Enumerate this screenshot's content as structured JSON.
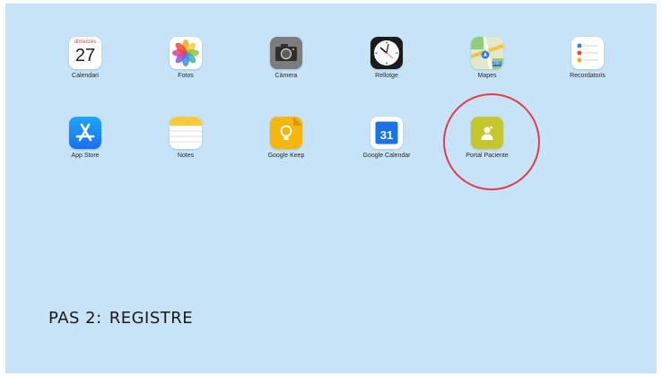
{
  "apps": [
    {
      "id": "calendari",
      "label": "Calendari",
      "weekday": "dimecres",
      "day": "27"
    },
    {
      "id": "fotos",
      "label": "Fotos"
    },
    {
      "id": "camera",
      "label": "Càmera"
    },
    {
      "id": "rellotge",
      "label": "Rellotge"
    },
    {
      "id": "mapes",
      "label": "Mapes",
      "badge": "280"
    },
    {
      "id": "recordatoris",
      "label": "Recordatoris"
    },
    {
      "id": "appstore",
      "label": "App Store"
    },
    {
      "id": "notes",
      "label": "Notes"
    },
    {
      "id": "keep",
      "label": "Google Keep"
    },
    {
      "id": "gcal",
      "label": "Google Calendar",
      "day": "31"
    },
    {
      "id": "portal",
      "label": "Portal Paciente"
    }
  ],
  "caption": {
    "step": "PAS 2:",
    "title": "REGISTRE"
  },
  "colors": {
    "wallpaper": "#c6e3f8",
    "highlight": "#e5394b",
    "portal": "#c4c62c"
  },
  "icons": {
    "calendari": "calendar-icon",
    "fotos": "photos-icon",
    "camera": "camera-icon",
    "rellotge": "clock-icon",
    "mapes": "maps-icon",
    "recordatoris": "reminders-icon",
    "appstore": "app-store-icon",
    "notes": "notes-icon",
    "keep": "google-keep-icon",
    "gcal": "google-calendar-icon",
    "portal": "portal-paciente-icon"
  }
}
